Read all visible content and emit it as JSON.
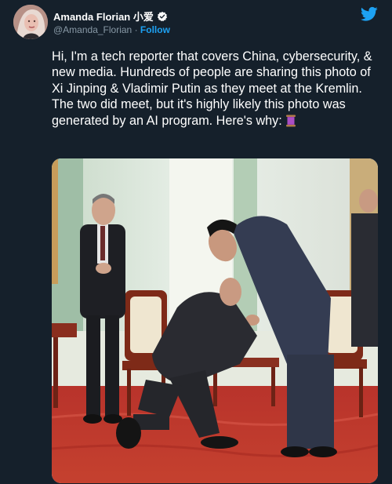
{
  "author": {
    "display_name": "Amanda Florian 小爱",
    "handle": "@Amanda_Florian",
    "separator": "·",
    "follow_label": "Follow"
  },
  "tweet": {
    "text": "Hi, I'm a tech reporter that covers China, cybersecurity, & new media. Hundreds of people are sharing this photo of Xi Jinping & Vladimir Putin as they meet at the Kremlin. The two did meet, but it's highly likely this photo was generated by an AI program. Here's why: "
  },
  "icons": {
    "avatar": "avatar",
    "verified": "verified-badge-icon",
    "brand": "twitter-bird-icon",
    "emoji": "thread-spool-emoji"
  },
  "colors": {
    "background": "#15202b",
    "text": "#ffffff",
    "muted": "#8899a6",
    "accent": "#1da1f2"
  }
}
